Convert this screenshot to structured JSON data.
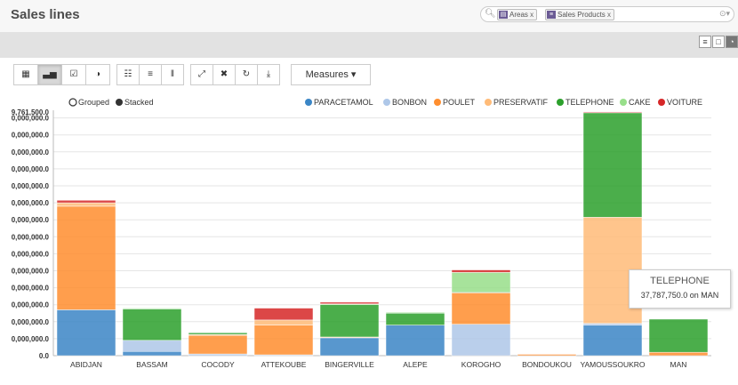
{
  "header": {
    "title": "Sales lines",
    "facets": [
      {
        "label": "Areas",
        "icon": "filter-icon"
      },
      {
        "label": "Sales Products",
        "icon": "group-icon"
      }
    ]
  },
  "toolbar": {
    "measures_label": "Measures"
  },
  "colors": {
    "PARACETAMOL": "#3b86c6",
    "BONBON": "#aec7e8",
    "POULET": "#ff8e2f",
    "PRESERVATIF": "#ffbb78",
    "TELEPHONE": "#2ca02c",
    "CAKE": "#98df8a",
    "VOITURE": "#d62728"
  },
  "tooltip": {
    "title": "TELEPHONE",
    "value": "37,787,750.0 on MAN"
  },
  "chart_data": {
    "type": "bar",
    "stacked": true,
    "mode_labels": {
      "grouped": "Grouped",
      "stacked": "Stacked"
    },
    "y_top_label": "9,761,500.0",
    "ytick_labels": [
      "0.0",
      "0,000,000.0",
      "0,000,000.0",
      "0,000,000.0",
      "0,000,000.0",
      "0,000,000.0",
      "0,000,000.0",
      "0,000,000.0",
      "0,000,000.0",
      "0,000,000.0",
      "0,000,000.0",
      "0,000,000.0",
      "0,000,000.0",
      "0,000,000.0",
      "0,000,000.0"
    ],
    "ylim": [
      0,
      14
    ],
    "categories": [
      "ABIDJAN",
      "BASSAM",
      "COCODY",
      "ATTEKOUBE",
      "BINGERVILLE",
      "ALEPE",
      "KOROGHO",
      "BONDOUKOU",
      "YAMOUSSOUKRO",
      "MAN"
    ],
    "series": [
      {
        "name": "PARACETAMOL",
        "values": [
          2.7,
          0.25,
          0,
          0,
          1.05,
          1.8,
          0,
          0,
          1.8,
          0
        ]
      },
      {
        "name": "BONBON",
        "values": [
          0,
          0.65,
          0.1,
          0.05,
          0,
          0,
          1.85,
          0,
          0.1,
          0
        ]
      },
      {
        "name": "POULET",
        "values": [
          6.1,
          0,
          1.1,
          1.75,
          0,
          0,
          1.85,
          0.08,
          0,
          0.2
        ]
      },
      {
        "name": "PRESERVATIF",
        "values": [
          0.2,
          0,
          0.05,
          0.3,
          0.05,
          0,
          0,
          0,
          6.25,
          0
        ]
      },
      {
        "name": "TELEPHONE",
        "values": [
          0,
          1.85,
          0.1,
          0,
          1.9,
          0.7,
          0.05,
          0,
          6.15,
          1.95
        ]
      },
      {
        "name": "CAKE",
        "values": [
          0,
          0.05,
          0,
          0,
          0.05,
          0.05,
          1.15,
          0,
          0,
          0
        ]
      },
      {
        "name": "VOITURE",
        "values": [
          0.15,
          0,
          0,
          0.7,
          0.1,
          0,
          0.15,
          0,
          0.05,
          0
        ]
      }
    ]
  }
}
